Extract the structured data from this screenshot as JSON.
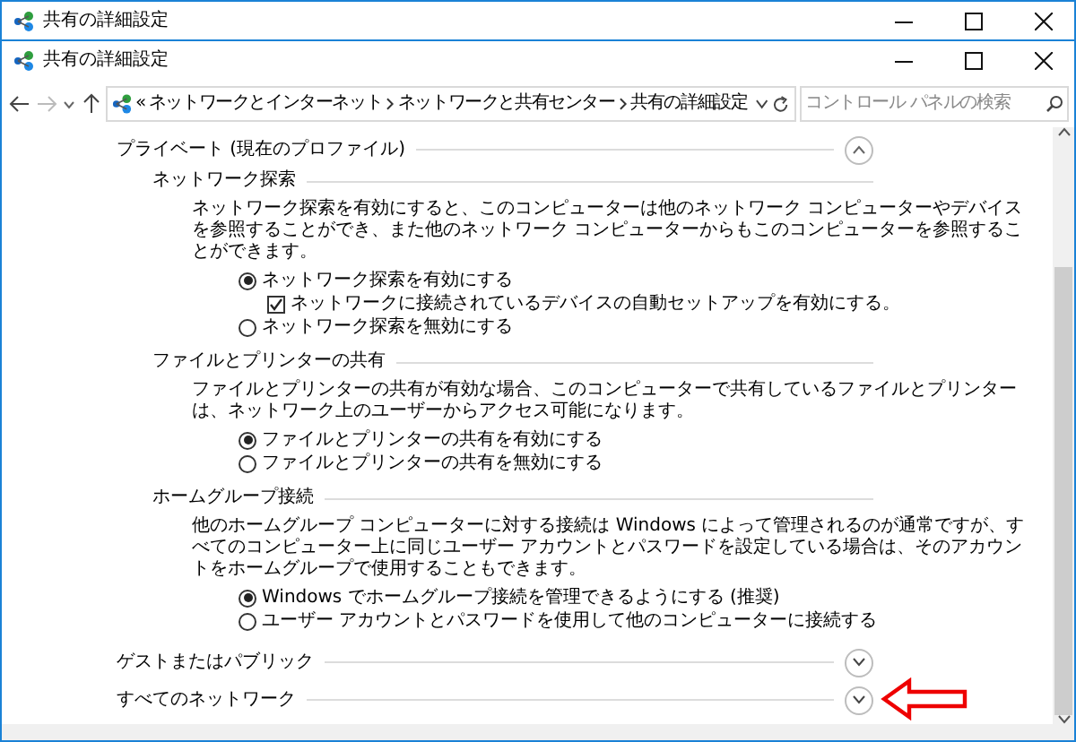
{
  "window": {
    "title": "共有の詳細設定"
  },
  "inner_window": {
    "title": "共有の詳細設定"
  },
  "address_bar": {
    "prefix": "«",
    "path": [
      "ネットワークとインターネット",
      "ネットワークと共有センター",
      "共有の詳細設定"
    ]
  },
  "search": {
    "placeholder": "コントロール パネルの検索"
  },
  "profiles": [
    {
      "title": "プライベート (現在のプロファイル)",
      "expanded": true,
      "sections": [
        {
          "title": "ネットワーク探索",
          "description": "ネットワーク探索を有効にすると、このコンピューターは他のネットワーク コンピューターやデバイスを参照することができ、また他のネットワーク コンピューターからもこのコンピューターを参照することができます。",
          "options": [
            {
              "kind": "radio",
              "label": "ネットワーク探索を有効にする",
              "selected": true,
              "children": [
                {
                  "kind": "checkbox",
                  "label": "ネットワークに接続されているデバイスの自動セットアップを有効にする。",
                  "checked": true
                }
              ]
            },
            {
              "kind": "radio",
              "label": "ネットワーク探索を無効にする",
              "selected": false
            }
          ]
        },
        {
          "title": "ファイルとプリンターの共有",
          "description": "ファイルとプリンターの共有が有効な場合、このコンピューターで共有しているファイルとプリンターは、ネットワーク上のユーザーからアクセス可能になります。",
          "options": [
            {
              "kind": "radio",
              "label": "ファイルとプリンターの共有を有効にする",
              "selected": true
            },
            {
              "kind": "radio",
              "label": "ファイルとプリンターの共有を無効にする",
              "selected": false
            }
          ]
        },
        {
          "title": "ホームグループ接続",
          "description": "他のホームグループ コンピューターに対する接続は Windows によって管理されるのが通常ですが、すべてのコンピューター上に同じユーザー アカウントとパスワードを設定している場合は、そのアカウントをホームグループで使用することもできます。",
          "options": [
            {
              "kind": "radio",
              "label": "Windows でホームグループ接続を管理できるようにする (推奨)",
              "selected": true
            },
            {
              "kind": "radio",
              "label": "ユーザー アカウントとパスワードを使用して他のコンピューターに接続する",
              "selected": false
            }
          ]
        }
      ]
    },
    {
      "title": "ゲストまたはパブリック",
      "expanded": false
    },
    {
      "title": "すべてのネットワーク",
      "expanded": false
    }
  ]
}
